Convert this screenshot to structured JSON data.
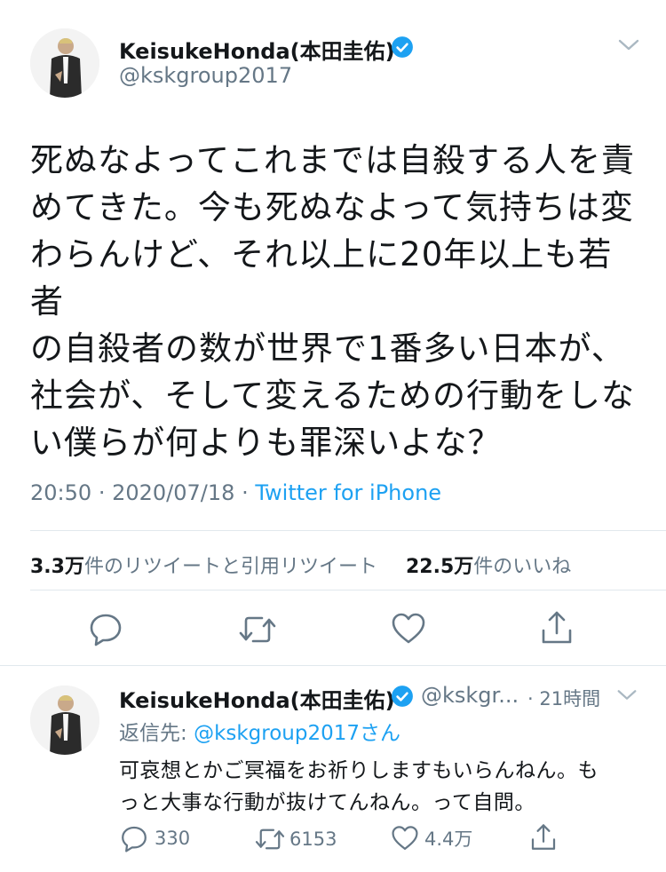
{
  "tweet": {
    "author_name": "KeisukeHonda(本田圭佑)",
    "author_handle": "@kskgroup2017",
    "text_lines": [
      "死ぬなよってこれまでは自殺する人を責",
      "めてきた。今も死ぬなよって気持ちは変",
      "わらんけど、それ以上に20年以上も若者",
      "の自殺者の数が世界で1番多い日本が、",
      "社会が、そして変えるための行動をしな",
      "い僕らが何よりも罪深いよな？"
    ],
    "time": "20:50",
    "date": "2020/07/18",
    "separator": "·",
    "source": "Twitter for iPhone",
    "retweet_count": "3.3万",
    "retweet_label": "件のリツイートと引用リツイート",
    "like_count": "22.5万",
    "like_label": "件のいいね"
  },
  "reply": {
    "author_name": "KeisukeHonda(本田圭佑)",
    "author_handle": "@kskgr...",
    "time_ago": "· 21時間",
    "replying_to_label": "返信先: ",
    "replying_to_handle": "@kskgroup2017さん",
    "text_lines": [
      "可哀想とかご冥福をお祈りしますもいらんねん。も",
      "っと大事な行動が抜けてんねん。って自問。"
    ],
    "reply_count": "330",
    "retweet_count": "6153",
    "like_count": "4.4万"
  },
  "colors": {
    "accent": "#1da1f2",
    "secondary_text": "#657786",
    "divider": "#e1e8ed"
  },
  "icons": [
    "verified-badge-icon",
    "chevron-down-icon",
    "reply-icon",
    "retweet-icon",
    "like-icon",
    "share-icon"
  ]
}
